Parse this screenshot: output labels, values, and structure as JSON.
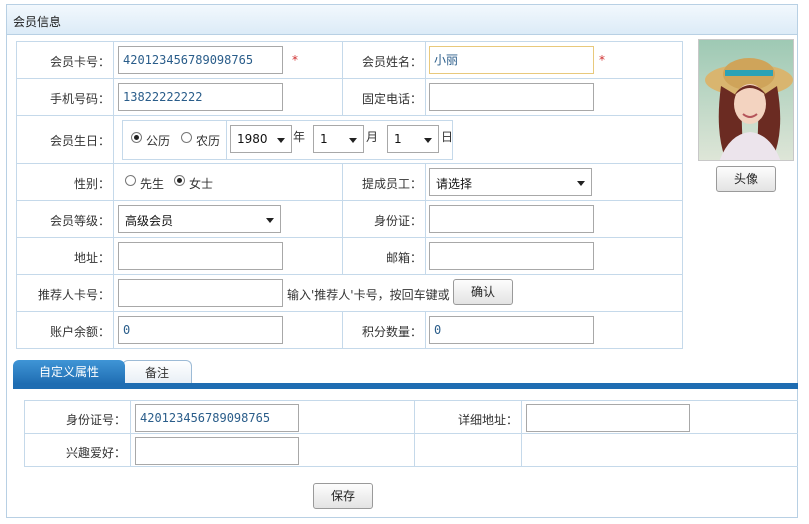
{
  "panel": {
    "title": "会员信息"
  },
  "form": {
    "card_no": {
      "label": "会员卡号：",
      "value": "420123456789098765"
    },
    "name": {
      "label": "会员姓名：",
      "value": "小丽"
    },
    "mobile": {
      "label": "手机号码：",
      "value": "13822222222"
    },
    "phone": {
      "label": "固定电话：",
      "value": ""
    },
    "birthday": {
      "label": "会员生日：",
      "calendar_solar": "公历",
      "calendar_lunar": "农历",
      "selected_calendar": "公历",
      "year": "1980",
      "year_unit": "年",
      "month": "1",
      "month_unit": "月",
      "day": "1",
      "day_unit": "日"
    },
    "gender": {
      "label": "性别：",
      "male": "先生",
      "female": "女士",
      "selected": "女士"
    },
    "staff": {
      "label": "提成员工：",
      "value": "请选择"
    },
    "level": {
      "label": "会员等级：",
      "value": "高级会员"
    },
    "id_card": {
      "label": "身份证：",
      "value": ""
    },
    "address": {
      "label": "地址：",
      "value": ""
    },
    "email": {
      "label": "邮箱：",
      "value": ""
    },
    "referrer": {
      "label": "推荐人卡号：",
      "value": "",
      "hint": "输入'推荐人'卡号，按回车键或",
      "confirm": "确认"
    },
    "balance": {
      "label": "账户余额：",
      "value": "0"
    },
    "points": {
      "label": "积分数量：",
      "value": "0"
    },
    "required_mark": "*"
  },
  "avatar": {
    "button": "头像"
  },
  "tabs": {
    "custom": "自定义属性",
    "notes": "备注"
  },
  "custom": {
    "id_no": {
      "label": "身份证号：",
      "value": "420123456789098765"
    },
    "detail_address": {
      "label": "详细地址：",
      "value": ""
    },
    "hobby": {
      "label": "兴趣爱好：",
      "value": ""
    }
  },
  "actions": {
    "save": "保存"
  },
  "colors": {
    "accent": "#1f6db2",
    "border": "#c5d9ea",
    "required": "#d03030"
  }
}
